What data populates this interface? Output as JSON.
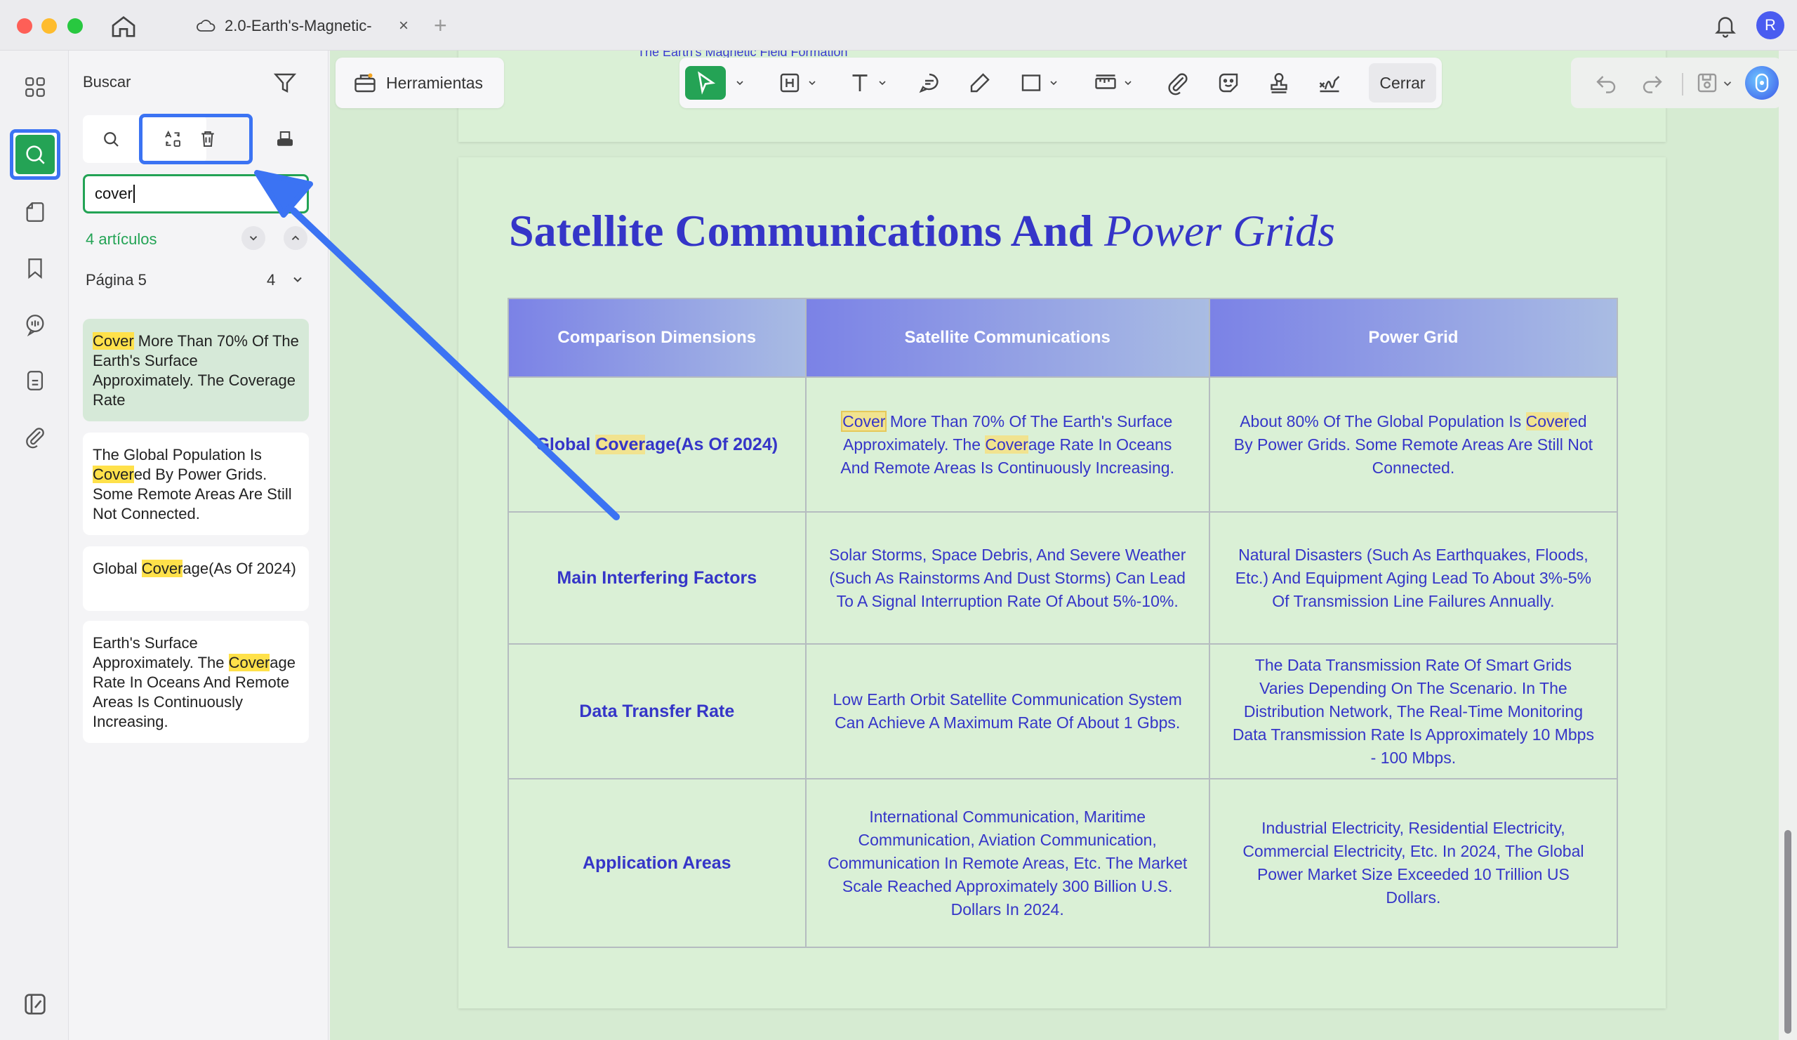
{
  "window": {
    "tab_title": "2.0-Earth's-Magnetic-",
    "tab_close": "×",
    "tab_add": "+",
    "avatar_letter": "R"
  },
  "icons": {
    "home": "home-icon",
    "cloud": "cloud-icon",
    "bell": "bell-icon",
    "grid": "grid-icon",
    "search": "search-icon",
    "pages": "page-icon",
    "bookmark": "bookmark-icon",
    "ai_chat": "ai-chat-icon",
    "document": "document-icon",
    "attachment": "paperclip-icon",
    "filter": "filter-icon",
    "replace": "replace-icon",
    "delete": "trash-icon",
    "redact": "redact-icon"
  },
  "search_panel": {
    "title": "Buscar",
    "query": "cover",
    "result_count": "4 artículos",
    "page_label": "Página 5",
    "page_count": "4",
    "results": [
      {
        "hl": "Cover",
        "rest": " More Than 70% Of The Earth's Surface Approximately. The Coverage Rate"
      },
      {
        "pre": "The Global Population Is ",
        "hl": "Cover",
        "rest": "ed By Power Grids. Some Remote Areas Are Still Not Connected."
      },
      {
        "pre": "Global ",
        "hl": "Cover",
        "rest": "age(As Of 2024)"
      },
      {
        "pre": "Earth's Surface Approximately. The ",
        "hl": "Cover",
        "rest": "age Rate In Oceans And Remote Areas Is Continuously Increasing."
      }
    ]
  },
  "toolbar": {
    "tools_label": "Herramientas",
    "close_label": "Cerrar"
  },
  "document": {
    "prev_page_title": "The Earth's Magnetic Field Formation",
    "title_bold": "Satellite Communications And ",
    "title_italic": "Power Grids",
    "table": {
      "headers": [
        "Comparison Dimensions",
        "Satellite Communications",
        "Power Grid"
      ],
      "rows": [
        {
          "dim_pre": "Global ",
          "dim_hl": "Cover",
          "dim_rest": "age(As Of 2024)",
          "sat_hl1": "Cover",
          "sat_mid": " More Than 70% Of The Earth's Surface Approximately. The ",
          "sat_hl2": "Cover",
          "sat_rest": "age Rate In Oceans And Remote Areas Is Continuously Increasing.",
          "pow_pre": "About 80% Of The Global Population Is ",
          "pow_hl": "Cover",
          "pow_rest": "ed By Power Grids. Some Remote Areas Are Still Not Connected."
        },
        {
          "dim": "Main Interfering Factors",
          "sat": "Solar Storms, Space Debris, And Severe Weather (Such As Rainstorms And Dust Storms) Can Lead To A Signal Interruption Rate Of About 5%-10%.",
          "pow": "Natural Disasters (Such As Earthquakes, Floods, Etc.) And Equipment Aging Lead To About 3%-5% Of Transmission Line Failures Annually."
        },
        {
          "dim": "Data Transfer Rate",
          "sat": "Low Earth Orbit Satellite Communication System Can Achieve A Maximum Rate Of About 1 Gbps.",
          "pow": "The Data Transmission Rate Of Smart Grids Varies Depending On The Scenario. In The Distribution Network, The Real-Time Monitoring Data Transmission Rate Is Approximately 10 Mbps - 100 Mbps."
        },
        {
          "dim": "Application Areas",
          "sat": "International Communication, Maritime Communication, Aviation Communication, Communication In Remote Areas, Etc. The Market Scale Reached Approximately 300 Billion U.S. Dollars In 2024.",
          "pow": "Industrial Electricity, Residential Electricity, Commercial Electricity, Etc. In 2024, The Global Power Market Size Exceeded 10 Trillion US Dollars."
        }
      ]
    }
  },
  "colors": {
    "accent_green": "#24a355",
    "annotation_blue": "#3b73f3",
    "doc_text": "#3535c8",
    "highlight": "#ffe14a"
  }
}
